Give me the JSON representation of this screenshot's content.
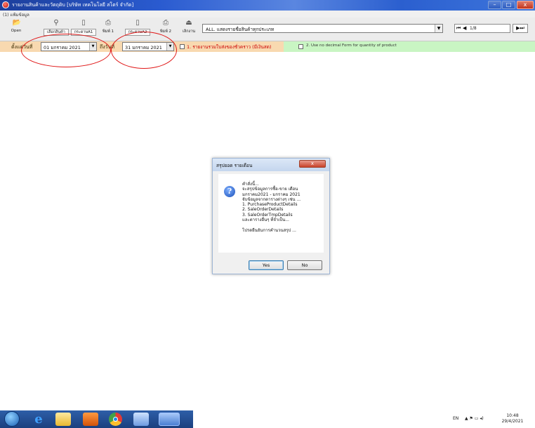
{
  "window": {
    "title": "รายงานสินค้าและวัตถุดิบ [บริษัท เทคโนโลยี สโตร์ จำกัด]",
    "controls": {
      "minimize": "–",
      "maximize": "□",
      "close": "x"
    }
  },
  "menu": {
    "file": "(1) แฟ้มข้อมูล"
  },
  "toolbar": {
    "buttons": [
      {
        "label": "Open",
        "icon": "folder-icon",
        "glyph": "📂"
      },
      {
        "label": "เลือกสินค้า",
        "icon": "binoculars-icon",
        "glyph": "⚲"
      },
      {
        "label": "กระดาษA1",
        "icon": "page-icon",
        "glyph": "▯"
      },
      {
        "label": "พิมพ์ 1",
        "icon": "printer-icon",
        "glyph": "⎙"
      },
      {
        "label": "กระดาษA2",
        "icon": "page-icon",
        "glyph": "▯"
      },
      {
        "label": "พิมพ์ 2",
        "icon": "printer-icon",
        "glyph": "⎙"
      },
      {
        "label": "เลิกงาน",
        "icon": "exit-icon",
        "glyph": "⏏"
      }
    ],
    "report_select": "ALL. แสดงรายชื่อสินค้าทุกประเภท",
    "nav": {
      "first": "⏮",
      "prev": "◀",
      "count": "1/8",
      "next": "▶",
      "last": "⏭"
    }
  },
  "filters": {
    "from_label": "ตั้งแต่วันที่",
    "from_date": "01  มกราคม  2021",
    "to_label": "ถึงวันที่",
    "to_date": "31  มกราคม  2021",
    "option1_label": "1. รายงานรวมใบส่งของชั่วคราว (มีเงินสด)",
    "option2_label": "2. Use no decimal Form for quantity of product",
    "dropdown_arrow": "▼"
  },
  "dialog": {
    "title": "สรุปยอด รายเดือน",
    "close": "x",
    "icon": "?",
    "message_lines": [
      "คำสั่งนี้...",
      "จะสรุปข้อมูลการซื้อ-ขาย เดือน",
      "มกราคม2021 - มกราคม 2021",
      "จับข้อมูลจากตารางต่างๆ เช่น ...",
      "1. PurchaseProductDetails",
      "2. SaleOrderDetails",
      "3. SaleOrderTmpDetails",
      "และตารางอื่นๆ ที่จำเป็น...",
      "",
      "โปรดยืนยันการคำนวนสรุป ..."
    ],
    "yes_label": "Yes",
    "no_label": "No"
  },
  "taskbar": {
    "language": "EN",
    "tray": "▲  ⚑  ▭  ◂)",
    "time": "10:48",
    "date": "29/4/2021"
  },
  "colors": {
    "titlebar": "#2a5bd0",
    "filter_bar": "#f8d9b0",
    "option_bar": "#c9f5c3",
    "annotation": "#e01818",
    "taskbar": "#1b3f7e"
  }
}
